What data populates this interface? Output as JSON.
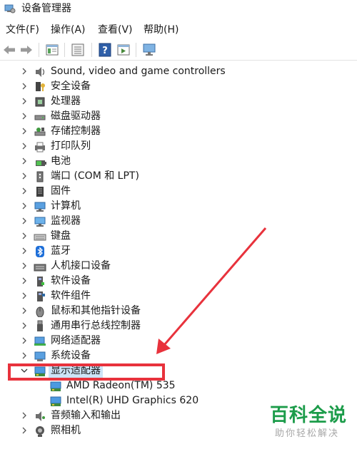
{
  "window": {
    "title": "设备管理器"
  },
  "menu": [
    {
      "label": "文件(F)"
    },
    {
      "label": "操作(A)"
    },
    {
      "label": "查看(V)"
    },
    {
      "label": "帮助(H)"
    }
  ],
  "toolbar": {
    "buttons": [
      {
        "icon": "back-arrow-icon"
      },
      {
        "icon": "forward-arrow-icon"
      },
      {
        "icon": "properties-icon"
      },
      {
        "icon": "list-view-icon"
      },
      {
        "icon": "help-icon"
      },
      {
        "icon": "action-pane-icon"
      },
      {
        "icon": "scan-hardware-icon"
      }
    ]
  },
  "tree": {
    "items": [
      {
        "label": "Sound, video and game controllers",
        "icon": "speaker-icon",
        "expanded": false
      },
      {
        "label": "安全设备",
        "icon": "security-key-icon",
        "expanded": false
      },
      {
        "label": "处理器",
        "icon": "processor-icon",
        "expanded": false
      },
      {
        "label": "磁盘驱动器",
        "icon": "disk-drive-icon",
        "expanded": false
      },
      {
        "label": "存储控制器",
        "icon": "storage-controller-icon",
        "expanded": false
      },
      {
        "label": "打印队列",
        "icon": "printer-icon",
        "expanded": false
      },
      {
        "label": "电池",
        "icon": "battery-icon",
        "expanded": false
      },
      {
        "label": "端口 (COM 和 LPT)",
        "icon": "port-icon",
        "expanded": false
      },
      {
        "label": "固件",
        "icon": "firmware-icon",
        "expanded": false
      },
      {
        "label": "计算机",
        "icon": "computer-icon",
        "expanded": false
      },
      {
        "label": "监视器",
        "icon": "monitor-icon",
        "expanded": false
      },
      {
        "label": "键盘",
        "icon": "keyboard-icon",
        "expanded": false
      },
      {
        "label": "蓝牙",
        "icon": "bluetooth-icon",
        "expanded": false
      },
      {
        "label": "人机接口设备",
        "icon": "hid-icon",
        "expanded": false
      },
      {
        "label": "软件设备",
        "icon": "software-device-icon",
        "expanded": false
      },
      {
        "label": "软件组件",
        "icon": "software-component-icon",
        "expanded": false
      },
      {
        "label": "鼠标和其他指针设备",
        "icon": "mouse-icon",
        "expanded": false
      },
      {
        "label": "通用串行总线控制器",
        "icon": "usb-icon",
        "expanded": false
      },
      {
        "label": "网络适配器",
        "icon": "network-adapter-icon",
        "expanded": false
      },
      {
        "label": "系统设备",
        "icon": "system-device-icon",
        "expanded": false
      },
      {
        "label": "显示适配器",
        "icon": "display-adapter-icon",
        "expanded": true,
        "selected": true
      },
      {
        "label": "AMD Radeon(TM) 535",
        "icon": "display-adapter-icon",
        "child": true
      },
      {
        "label": "Intel(R) UHD Graphics 620",
        "icon": "display-adapter-icon",
        "child": true
      },
      {
        "label": "音频输入和输出",
        "icon": "audio-io-icon",
        "expanded": false
      },
      {
        "label": "照相机",
        "icon": "camera-icon",
        "expanded": false
      }
    ]
  },
  "annotation": {
    "color": "#e8323c"
  },
  "watermark": {
    "title": "百科全说",
    "subtitle": "助你轻松解决",
    "color": "#1c9c4a"
  }
}
